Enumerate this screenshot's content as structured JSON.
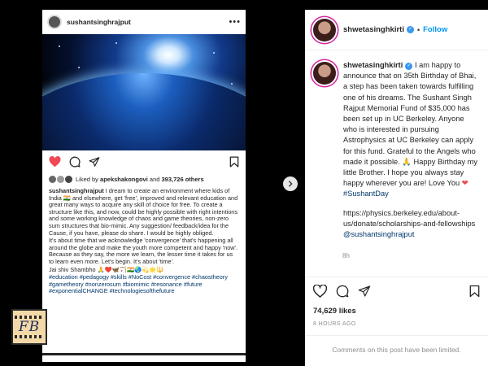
{
  "left_post": {
    "username": "sushantsinghrajput",
    "more_icon": "ellipsis-icon",
    "liked_by_prefix": "Liked by",
    "liked_user": "apekshakongovi",
    "liked_and": "and",
    "liked_count": "393,726 others",
    "caption_user": "sushantsinghrajput",
    "caption_p1": "I dream to create an environment where kids of India 🇮🇳 and elsewhere, get 'free', improved and relevant education and great many ways to acquire any skill of choice for free. To create a structure like this, and now, could be highly possible with right intentions and some working knowledge of chaos and game theories, non-zero sum structures that bio-mimic. Any suggestion/ feedback/idea for the Cause, if you have, please do share. I would be highly obliged.",
    "caption_p2": "It's about time that we acknowledge 'convergence' that's happening all around the globe and make the youth more competent and happy 'now'. Because as they say, the more we learn, the lesser time it takes for us to learn even more. Let's begin. It's about 'time'.",
    "caption_p3": "Jai shiv Shambho 🙏❤️🦋🏹🇮🇳🌏💫🌟🔱",
    "hashtags": "#education #pedagogy #skills #NoCost #convergence #chaostheory #gametheory #nonzerosum #biomimic #resonance #future #exponentialCHANGE #technologiesofthefuture"
  },
  "watermark": {
    "text": "FB"
  },
  "right_panel": {
    "username": "shwetasinghkirti",
    "dot": "•",
    "follow_label": "Follow",
    "comment_user": "shwetasinghkirti",
    "comment_text": "I am happy to announce that on 35th Birthday of Bhai, a step has been taken towards fulfilling one of his dreams. The Sushant Singh Rajput Memorial Fund of $35,000 has been set up in UC Berkeley. Anyone who is interested in pursuing Astrophysics at UC Berkeley can apply for this fund. Grateful to the Angels who made it possible. 🙏 Happy Birthday my little Brother. I hope you always stay happy wherever you are! Love You",
    "comment_tag": "#SushantDay",
    "comment_link": "https://physics.berkeley.edu/about-us/donate/scholarships-and-fellowships",
    "comment_mention": "@sushantsinghrajput",
    "comment_time": "8h",
    "likes": "74,629 likes",
    "time_ago": "8 HOURS AGO",
    "comments_limited": "Comments on this post have been limited."
  },
  "colors": {
    "accent_blue": "#0095f6",
    "like_red": "#ed4956",
    "link_navy": "#00376b"
  }
}
